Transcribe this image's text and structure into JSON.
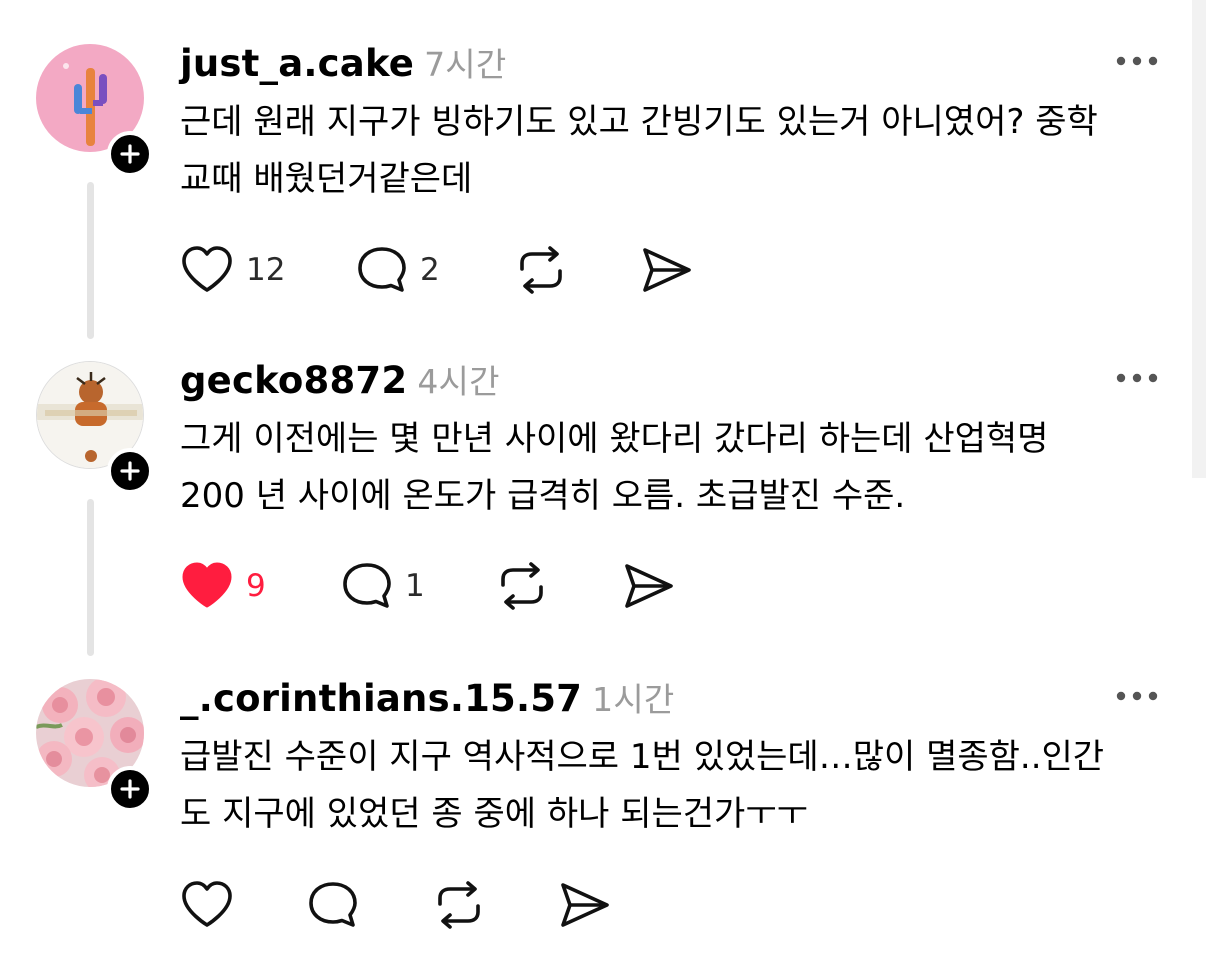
{
  "posts": [
    {
      "username": "just_a.cake",
      "time": "7시간",
      "text_line1": "근데 원래 지구가 빙하기도 있고 간빙기도 있는거 아니였어? 중학",
      "text_line2": "교때 배웠던거같은데",
      "likes": "12",
      "comments": "2",
      "liked": false
    },
    {
      "username": "gecko8872",
      "time": "4시간",
      "text_line1": "그게 이전에는 몇 만년 사이에 왔다리 갔다리 하는데 산업혁명",
      "text_line2": "200 년 사이에 온도가 급격히 오름. 초급발진 수준.",
      "likes": "9",
      "comments": "1",
      "liked": true
    },
    {
      "username": "_.corinthians.15.57",
      "time": "1시간",
      "text_line1": "급발진 수준이 지구 역사적으로 1번 있었는데…많이 멸종함..인간",
      "text_line2": "도 지구에 있었던 종 중에 하나 되는건가ㅜㅜ",
      "likes": "",
      "comments": "",
      "liked": false
    }
  ],
  "icons": {
    "like": "heart-icon",
    "comment": "comment-bubble-icon",
    "repost": "repost-icon",
    "share": "send-icon",
    "more": "more-dots-icon",
    "follow": "plus-icon"
  },
  "colors": {
    "liked": "#ff1d3f",
    "time": "#9b9b9b",
    "thread": "#e4e4e4"
  }
}
